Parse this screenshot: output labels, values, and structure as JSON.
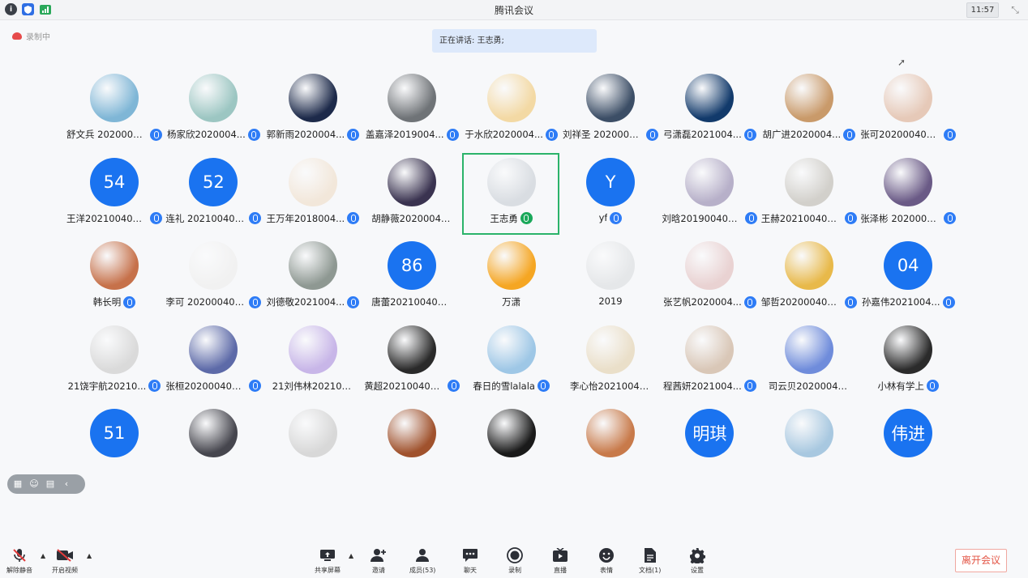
{
  "window": {
    "title": "腾讯会议",
    "clock": "11:57",
    "titlebar_icons": [
      "info-icon",
      "shield-icon",
      "signal-icon"
    ]
  },
  "recording": {
    "label": "录制中"
  },
  "speaking": {
    "text": "正在讲话: 王志勇;"
  },
  "participants": [
    {
      "name": "舒文兵 2020004...",
      "mic": "blue",
      "avatar": "photo",
      "color": "#7fb6d6"
    },
    {
      "name": "杨家欣2020004...",
      "mic": "blue",
      "avatar": "photo",
      "color": "#9cc6c2"
    },
    {
      "name": "郭新雨2020004...",
      "mic": "blue",
      "avatar": "photo",
      "color": "#1d2a4a"
    },
    {
      "name": "盖嘉泽2019004...",
      "mic": "blue",
      "avatar": "photo",
      "color": "#6f7377"
    },
    {
      "name": "于水欣2020004...",
      "mic": "blue",
      "avatar": "photo",
      "color": "#f3d9a4"
    },
    {
      "name": "刘祥圣 2020004...",
      "mic": "blue",
      "avatar": "photo",
      "color": "#3c4e66"
    },
    {
      "name": "弓潇磊2021004...",
      "mic": "blue",
      "avatar": "photo",
      "color": "#123a6b"
    },
    {
      "name": "胡广进2020004...",
      "mic": "blue",
      "avatar": "photo",
      "color": "#c99a6a"
    },
    {
      "name": "张可2020004000...",
      "mic": "blue",
      "avatar": "photo",
      "color": "#e6c9b8"
    },
    {
      "name": "王洋2021004000...",
      "mic": "blue",
      "avatar": "text",
      "initial": "54",
      "color": "#1a73f0"
    },
    {
      "name": "连礼 2021004000...",
      "mic": "blue",
      "avatar": "text",
      "initial": "52",
      "color": "#1a73f0"
    },
    {
      "name": "王万年2018004...",
      "mic": "blue",
      "avatar": "photo",
      "color": "#f2e7da"
    },
    {
      "name": "胡静薇2020004000...",
      "mic": "none",
      "avatar": "photo",
      "color": "#3a3350"
    },
    {
      "name": "王志勇",
      "mic": "green",
      "avatar": "photo",
      "color": "#d9dde2"
    },
    {
      "name": "yf",
      "mic": "blue",
      "avatar": "text",
      "initial": "Y",
      "color": "#1a73f0"
    },
    {
      "name": "刘晗2019004020...",
      "mic": "blue",
      "avatar": "photo",
      "color": "#b7b0c9"
    },
    {
      "name": "王赫2021004000...",
      "mic": "blue",
      "avatar": "photo",
      "color": "#d2d0cb"
    },
    {
      "name": "张泽彬 2020004...",
      "mic": "blue",
      "avatar": "photo",
      "color": "#6a5a86"
    },
    {
      "name": "韩长明",
      "mic": "blue",
      "avatar": "photo",
      "color": "#c6714a"
    },
    {
      "name": "李可 2020004000...",
      "mic": "blue",
      "avatar": "photo",
      "color": "#f1f1f1"
    },
    {
      "name": "刘德敬2021004...",
      "mic": "blue",
      "avatar": "photo",
      "color": "#8e9892"
    },
    {
      "name": "唐蕾202100400086",
      "mic": "none",
      "avatar": "text",
      "initial": "86",
      "color": "#1a73f0"
    },
    {
      "name": "万潇",
      "mic": "none",
      "avatar": "photo",
      "color": "#f5a623"
    },
    {
      "name": "2019",
      "mic": "none",
      "avatar": "photo",
      "color": "#e5e7e9"
    },
    {
      "name": "张艺帆2020004...",
      "mic": "blue",
      "avatar": "photo",
      "color": "#e9d2d2"
    },
    {
      "name": "邹哲2020004000...",
      "mic": "blue",
      "avatar": "photo",
      "color": "#e8b94a"
    },
    {
      "name": "孙嘉伟2021004...",
      "mic": "blue",
      "avatar": "text",
      "initial": "04",
      "color": "#1a73f0"
    },
    {
      "name": "21饶宇航20210...",
      "mic": "blue",
      "avatar": "photo",
      "color": "#dadada"
    },
    {
      "name": "张桓2020004000...",
      "mic": "blue",
      "avatar": "photo",
      "color": "#5d6aa8"
    },
    {
      "name": "21刘伟林20210040...",
      "mic": "none",
      "avatar": "photo",
      "color": "#c8b6e8"
    },
    {
      "name": "黄超2021004000...",
      "mic": "blue",
      "avatar": "photo",
      "color": "#2a2a2a"
    },
    {
      "name": "春日的雪lalala",
      "mic": "blue",
      "avatar": "photo",
      "color": "#9ec7e6"
    },
    {
      "name": "李心怡2021004001...",
      "mic": "none",
      "avatar": "photo",
      "color": "#eadfc9"
    },
    {
      "name": "程茜妍2021004...",
      "mic": "blue",
      "avatar": "photo",
      "color": "#d9c7b7"
    },
    {
      "name": "司云贝2020004000...",
      "mic": "none",
      "avatar": "photo",
      "color": "#6f8cdb"
    },
    {
      "name": "小林有学上",
      "mic": "blue",
      "avatar": "photo",
      "color": "#2b2b2b"
    },
    {
      "name": "",
      "mic": "none",
      "avatar": "text",
      "initial": "51",
      "color": "#1a73f0"
    },
    {
      "name": "",
      "mic": "none",
      "avatar": "photo",
      "color": "#46464e"
    },
    {
      "name": "",
      "mic": "none",
      "avatar": "photo",
      "color": "#d8d8d8"
    },
    {
      "name": "",
      "mic": "none",
      "avatar": "photo",
      "color": "#a0522d"
    },
    {
      "name": "",
      "mic": "none",
      "avatar": "photo",
      "color": "#1a1a1a"
    },
    {
      "name": "",
      "mic": "none",
      "avatar": "photo",
      "color": "#c87a4a"
    },
    {
      "name": "",
      "mic": "none",
      "avatar": "text",
      "initial": "明琪",
      "color": "#1a73f0"
    },
    {
      "name": "",
      "mic": "none",
      "avatar": "photo",
      "color": "#a8c8e0"
    },
    {
      "name": "",
      "mic": "none",
      "avatar": "text",
      "initial": "伟进",
      "color": "#1a73f0"
    }
  ],
  "floating_toolbar": {
    "icons": [
      "grid-view-icon",
      "emoji-icon",
      "keyboard-icon",
      "collapse-icon"
    ]
  },
  "toolbar": {
    "mute": "解除静音",
    "video": "开启视频",
    "share": "共享屏幕",
    "invite": "邀请",
    "members": "成员(53)",
    "chat": "聊天",
    "record": "录制",
    "live": "直播",
    "emoji": "表情",
    "docs": "文档(1)",
    "settings": "设置",
    "leave": "离开会议"
  }
}
